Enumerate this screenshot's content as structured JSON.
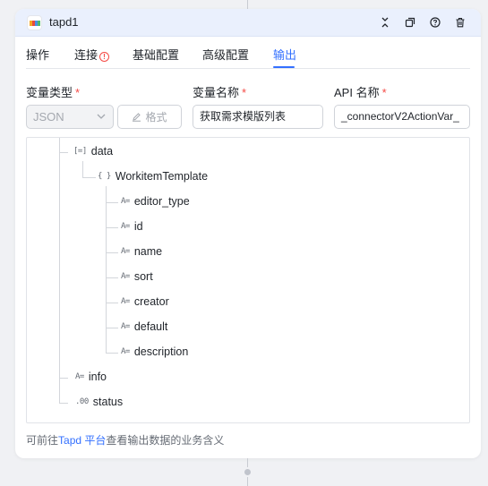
{
  "node": {
    "title": "tapd1",
    "app_icon": "tapd-logo-icon",
    "header_actions": [
      "collapse-icon",
      "copy-icon",
      "help-icon",
      "delete-icon"
    ]
  },
  "tabs": [
    {
      "label": "操作",
      "active": false
    },
    {
      "label": "连接",
      "active": false,
      "warning": true
    },
    {
      "label": "基础配置",
      "active": false
    },
    {
      "label": "高级配置",
      "active": false
    },
    {
      "label": "输出",
      "active": true
    }
  ],
  "fields": {
    "var_type_label": "变量类型",
    "var_name_label": "变量名称",
    "api_name_label": "API 名称",
    "required_mark": "*",
    "var_type_value": "JSON",
    "format_label": "格式",
    "var_name_value": "获取需求模版列表",
    "api_name_value": "_connectorV2ActionVar_"
  },
  "tree": {
    "data_label": "data",
    "data_type_icon": "[=]",
    "template_label": "WorkitemTemplate",
    "template_type_icon": "{ }",
    "string_type_icon": "A=",
    "number_type_icon": ".00",
    "children": [
      "editor_type",
      "id",
      "name",
      "sort",
      "creator",
      "default",
      "description"
    ],
    "info_label": "info",
    "status_label": "status"
  },
  "footnote": {
    "prefix": "可前往",
    "link": "Tapd 平台",
    "suffix": "查看输出数据的业务含义"
  },
  "colors": {
    "accent": "#3370ff",
    "required": "#f54a45",
    "header_bg": "#eaf0fd"
  }
}
